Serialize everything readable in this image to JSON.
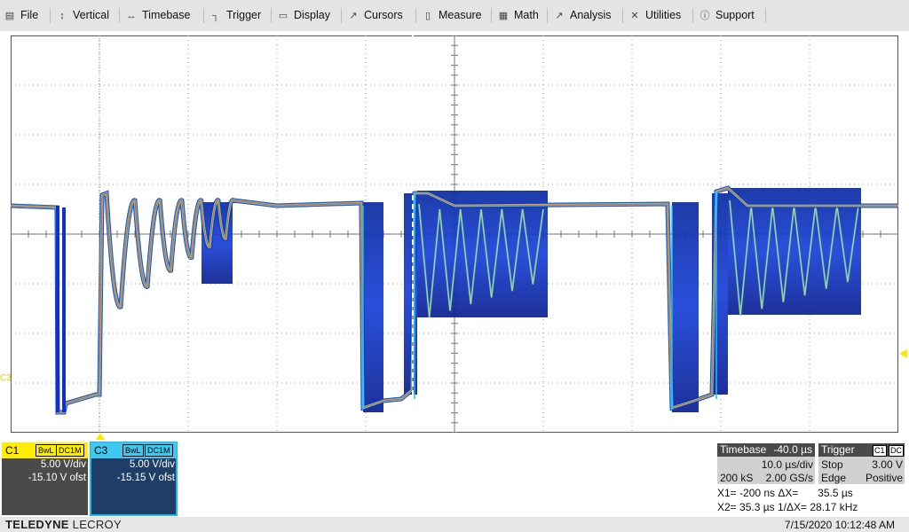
{
  "menu": [
    {
      "label": "File",
      "icon": "file-icon",
      "glyph": "▤"
    },
    {
      "label": "Vertical",
      "icon": "vertical-icon",
      "glyph": "↕"
    },
    {
      "label": "Timebase",
      "icon": "timebase-icon",
      "glyph": "↔"
    },
    {
      "label": "Trigger",
      "icon": "trigger-icon",
      "glyph": "┐"
    },
    {
      "label": "Display",
      "icon": "display-icon",
      "glyph": "▭"
    },
    {
      "label": "Cursors",
      "icon": "cursors-icon",
      "glyph": "↗"
    },
    {
      "label": "Measure",
      "icon": "measure-icon",
      "glyph": "▯"
    },
    {
      "label": "Math",
      "icon": "math-icon",
      "glyph": "▦"
    },
    {
      "label": "Analysis",
      "icon": "analysis-icon",
      "glyph": "↗"
    },
    {
      "label": "Utilities",
      "icon": "utilities-icon",
      "glyph": "✕"
    },
    {
      "label": "Support",
      "icon": "support-icon",
      "glyph": "ⓘ"
    }
  ],
  "channels": {
    "c1": {
      "name": "C1",
      "tag1": "BwL",
      "tag2": "DC1M",
      "vdiv": "5.00 V/div",
      "offset": "-15.10 V ofst",
      "color": "#ffee00"
    },
    "c3": {
      "name": "C3",
      "tag1": "BwL",
      "tag2": "DC1M",
      "vdiv": "5.00 V/div",
      "offset": "-15.15 V ofst",
      "color": "#3fc9ee"
    }
  },
  "timebase": {
    "label": "Timebase",
    "delay": "-40.0 µs",
    "tdiv": "10.0 µs/div",
    "samples": "200 kS",
    "rate": "2.00 GS/s"
  },
  "trigger": {
    "label": "Trigger",
    "source": "C1",
    "coupling": "DC",
    "mode": "Stop",
    "level": "3.00 V",
    "type": "Edge",
    "slope": "Positive"
  },
  "cursors": {
    "x1_label": "X1=",
    "x1": "-200 ns",
    "dx_label": "ΔX=",
    "dx": "35.5 µs",
    "x2_label": "X2=",
    "x2": "35.3 µs",
    "inv_label": "1/ΔX=",
    "inv": "28.17 kHz"
  },
  "trace_marker": "C3",
  "footer": {
    "brand_bold": "TELEDYNE",
    "brand_rest": " LECROY",
    "datetime": "7/15/2020 10:12:48 AM"
  },
  "colors": {
    "accent_c1": "#ffee00",
    "accent_c3": "#3fc9ee",
    "trace_fill": "#1030c8"
  }
}
